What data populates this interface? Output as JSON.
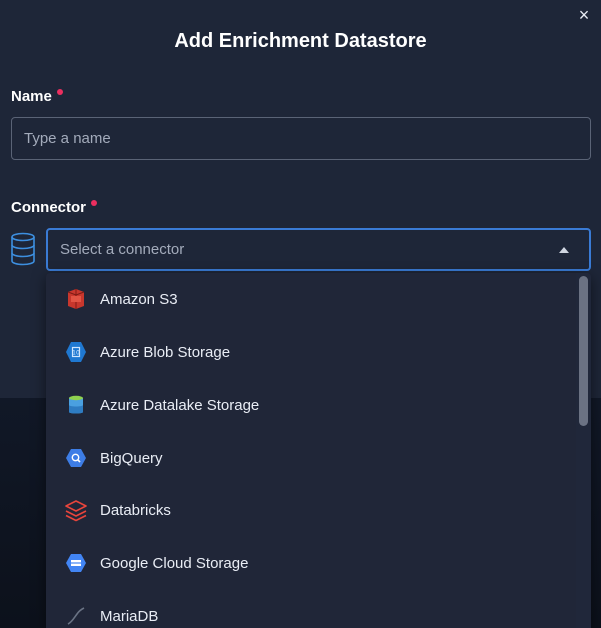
{
  "modal": {
    "title": "Add Enrichment Datastore",
    "close_label": "×"
  },
  "name_field": {
    "label": "Name",
    "placeholder": "Type a name",
    "value": ""
  },
  "connector_field": {
    "label": "Connector",
    "placeholder": "Select a connector",
    "options": [
      {
        "label": "Amazon S3",
        "icon": "amazon-s3-icon"
      },
      {
        "label": "Azure Blob Storage",
        "icon": "azure-blob-storage-icon"
      },
      {
        "label": "Azure Datalake Storage",
        "icon": "azure-datalake-storage-icon"
      },
      {
        "label": "BigQuery",
        "icon": "bigquery-icon"
      },
      {
        "label": "Databricks",
        "icon": "databricks-icon"
      },
      {
        "label": "Google Cloud Storage",
        "icon": "google-cloud-storage-icon"
      },
      {
        "label": "MariaDB",
        "icon": "mariadb-icon"
      }
    ]
  },
  "colors": {
    "modal_bg": "#1e2638",
    "accent": "#3a7bd5",
    "required": "#ec2e5f"
  }
}
